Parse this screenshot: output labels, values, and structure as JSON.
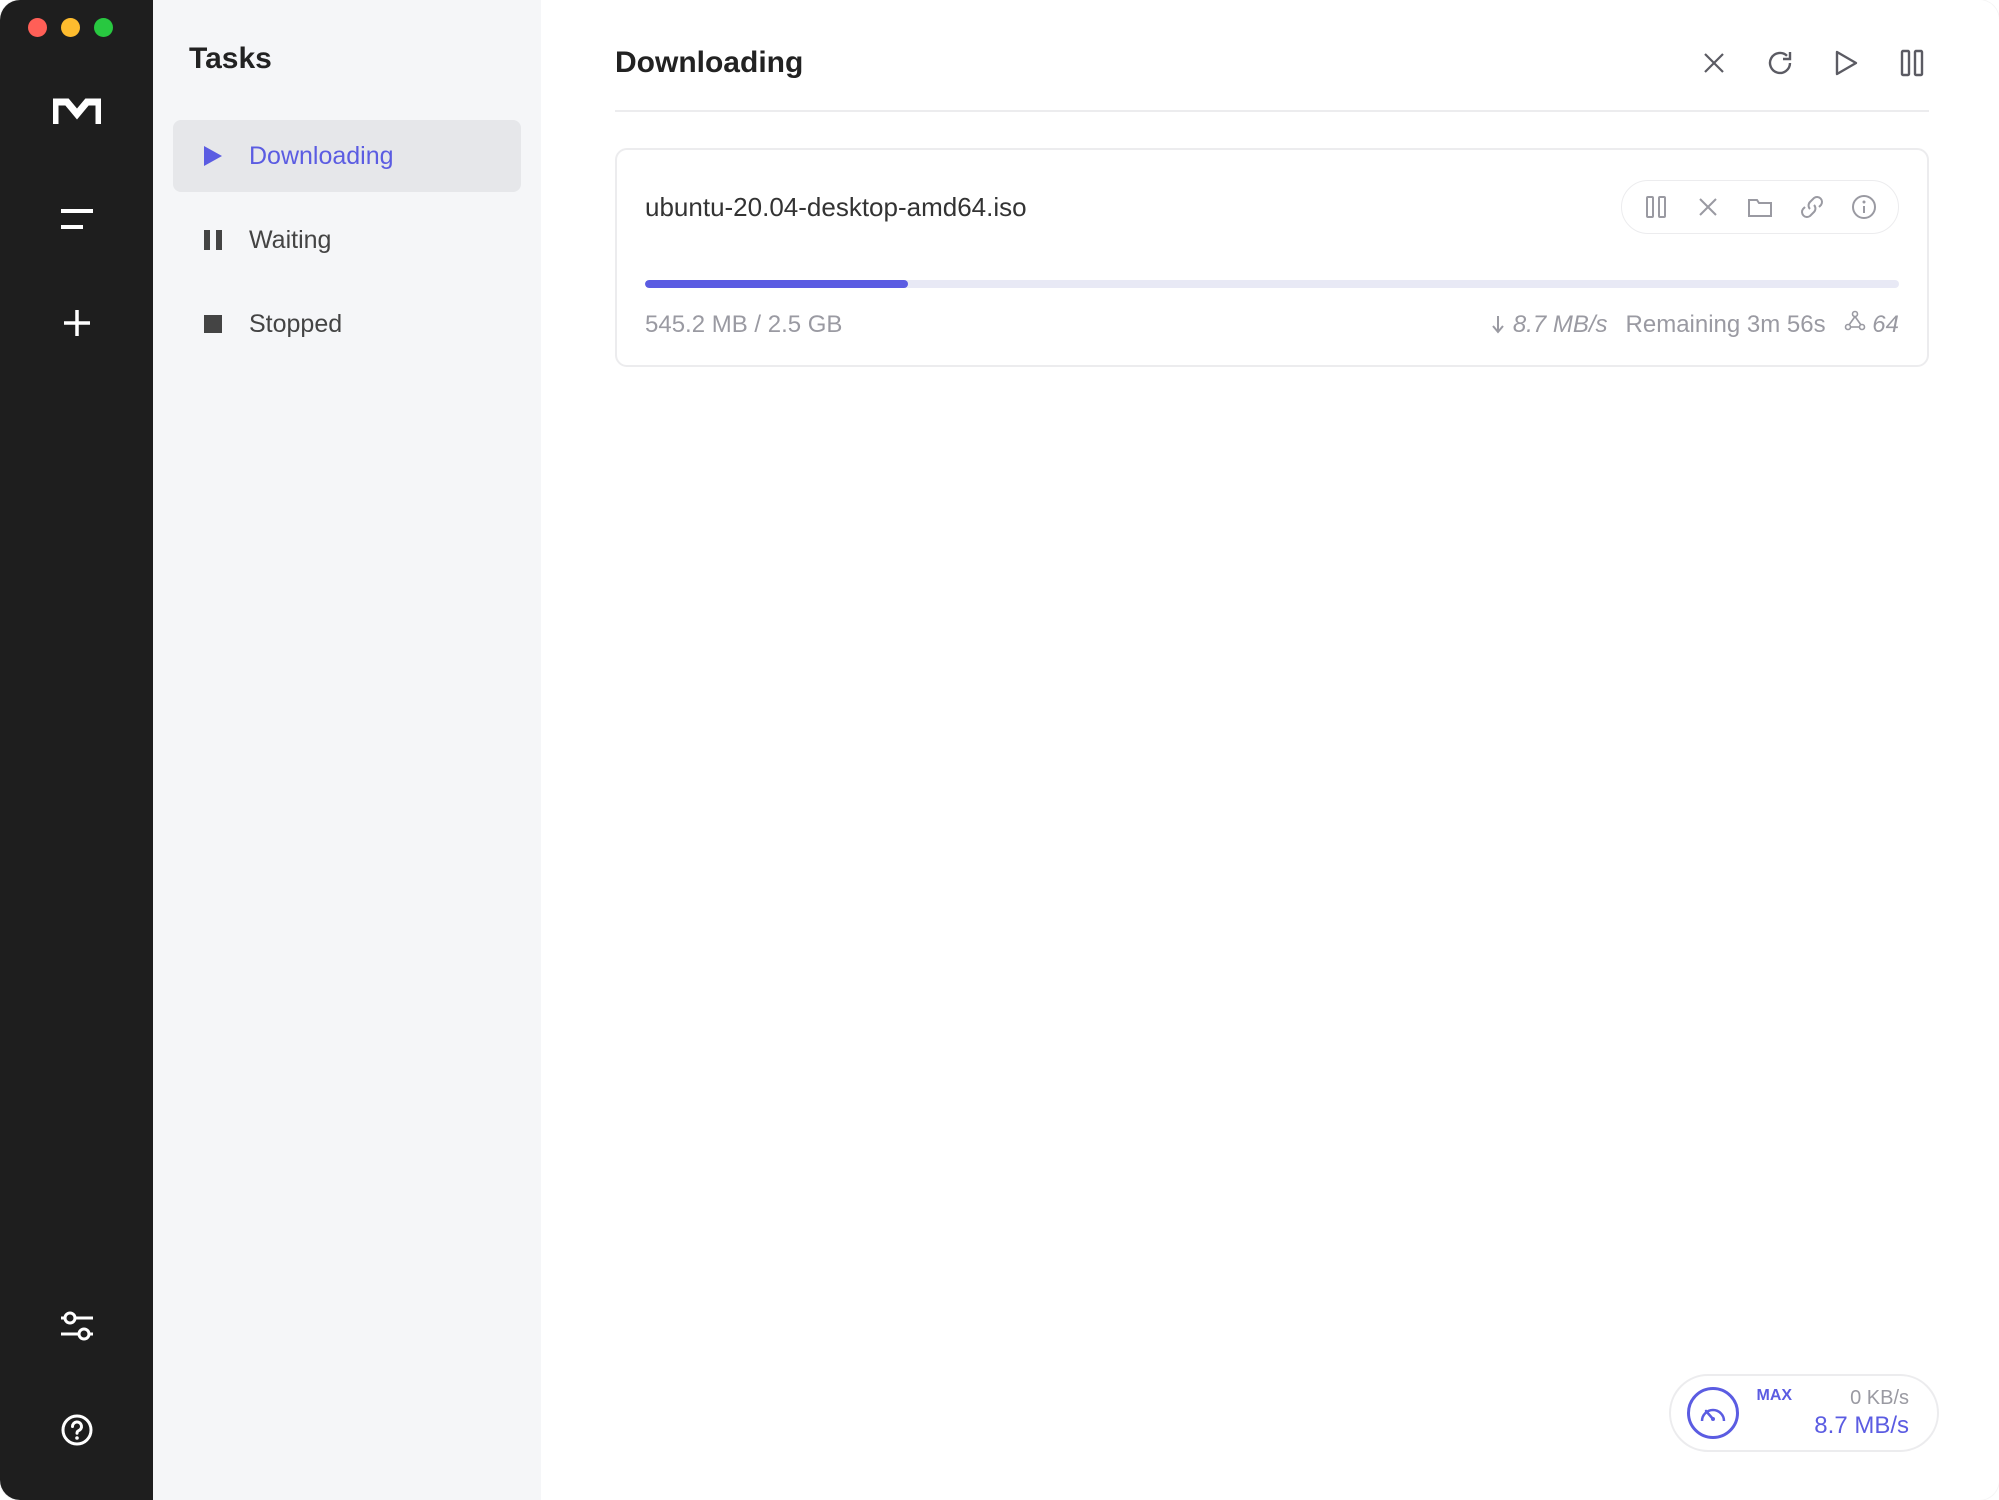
{
  "sidebar": {
    "title": "Tasks",
    "items": [
      {
        "label": "Downloading",
        "active": true
      },
      {
        "label": "Waiting",
        "active": false
      },
      {
        "label": "Stopped",
        "active": false
      }
    ]
  },
  "main": {
    "title": "Downloading"
  },
  "task": {
    "filename": "ubuntu-20.04-desktop-amd64.iso",
    "progress_text": "545.2 MB / 2.5 GB",
    "progress_percent": 21,
    "speed": "8.7 MB/s",
    "remaining": "Remaining 3m 56s",
    "peers": "64"
  },
  "speed_pill": {
    "label": "MAX",
    "upload": "0 KB/s",
    "download": "8.7 MB/s"
  }
}
